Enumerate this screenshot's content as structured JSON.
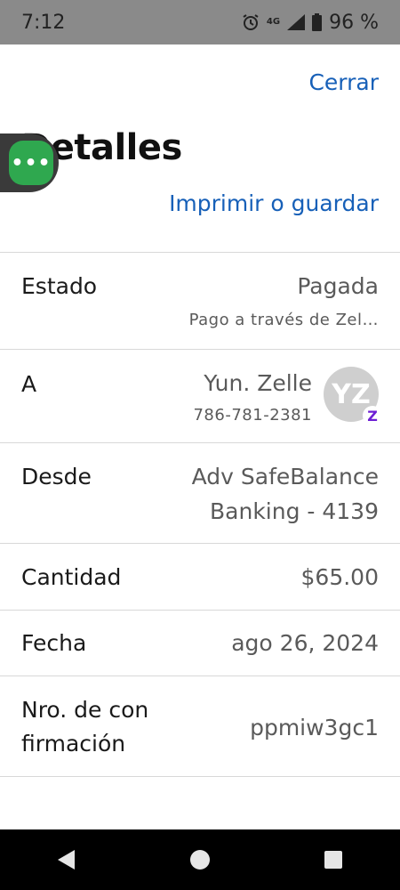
{
  "status_bar": {
    "time": "7:12",
    "network": "4G",
    "battery": "96 %"
  },
  "header": {
    "close_label": "Cerrar",
    "title": "Detalles",
    "print_label": "Imprimir o guardar"
  },
  "chat_bubble": {
    "glyph": "•••"
  },
  "details": {
    "status": {
      "label": "Estado",
      "value": "Pagada",
      "sub": "Pago a través de Zel…"
    },
    "recipient": {
      "label": "A",
      "name": "Yun. Zelle",
      "phone": "786-781-2381",
      "initials": "YZ",
      "badge": "Z"
    },
    "from": {
      "label": "Desde",
      "line1": "Adv SafeBalance",
      "line2": "Banking - 4139"
    },
    "amount": {
      "label": "Cantidad",
      "value": "$65.00"
    },
    "date": {
      "label": "Fecha",
      "value": "ago 26, 2024"
    },
    "confirmation": {
      "label_line1": "Nro. de con",
      "label_line2": "firmación",
      "value": "ppmiw3gc1"
    }
  },
  "colors": {
    "link": "#1760b8",
    "chat_green": "#2fa84f",
    "zelle_purple": "#6d1ed4"
  },
  "icons": [
    "alarm-icon",
    "signal-icon",
    "battery-icon",
    "back-icon",
    "home-icon",
    "recents-icon"
  ]
}
